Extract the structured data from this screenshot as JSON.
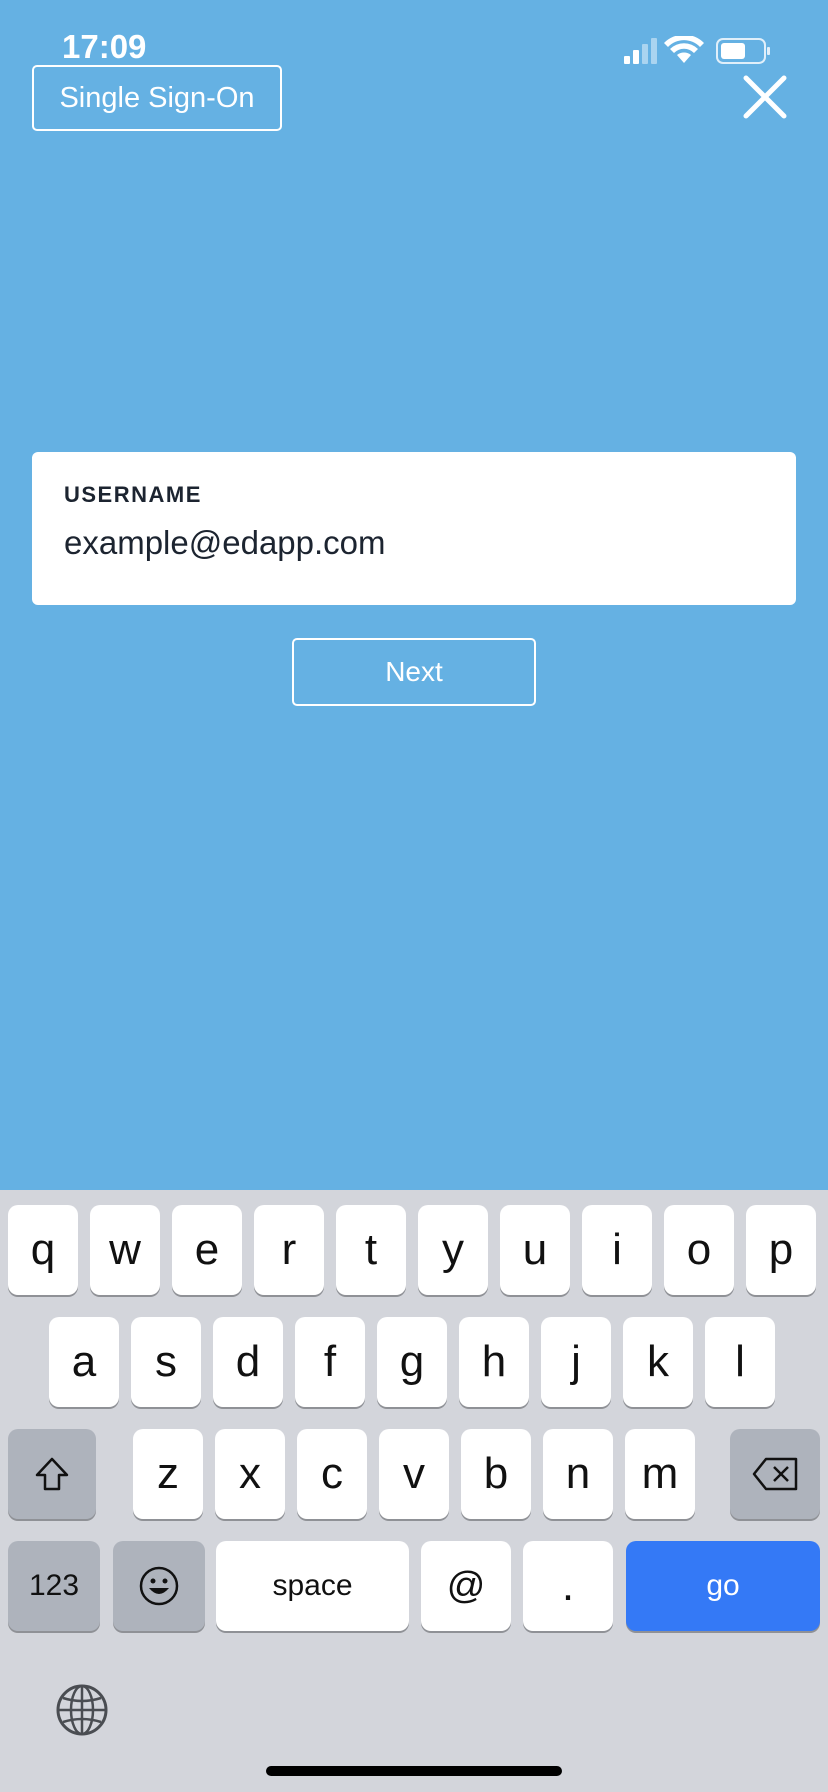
{
  "status_bar": {
    "time": "17:09"
  },
  "header": {
    "sso_label": "Single Sign-On"
  },
  "form": {
    "username_label": "USERNAME",
    "username_value": "example@edapp.com",
    "next_label": "Next"
  },
  "keyboard": {
    "row1": [
      "q",
      "w",
      "e",
      "r",
      "t",
      "y",
      "u",
      "i",
      "o",
      "p"
    ],
    "row2": [
      "a",
      "s",
      "d",
      "f",
      "g",
      "h",
      "j",
      "k",
      "l"
    ],
    "row3": [
      "z",
      "x",
      "c",
      "v",
      "b",
      "n",
      "m"
    ],
    "numbers_label": "123",
    "space_label": "space",
    "at_label": "@",
    "dot_label": ".",
    "go_label": "go"
  },
  "colors": {
    "background": "#65b1e3",
    "go_key": "#3479f6"
  }
}
